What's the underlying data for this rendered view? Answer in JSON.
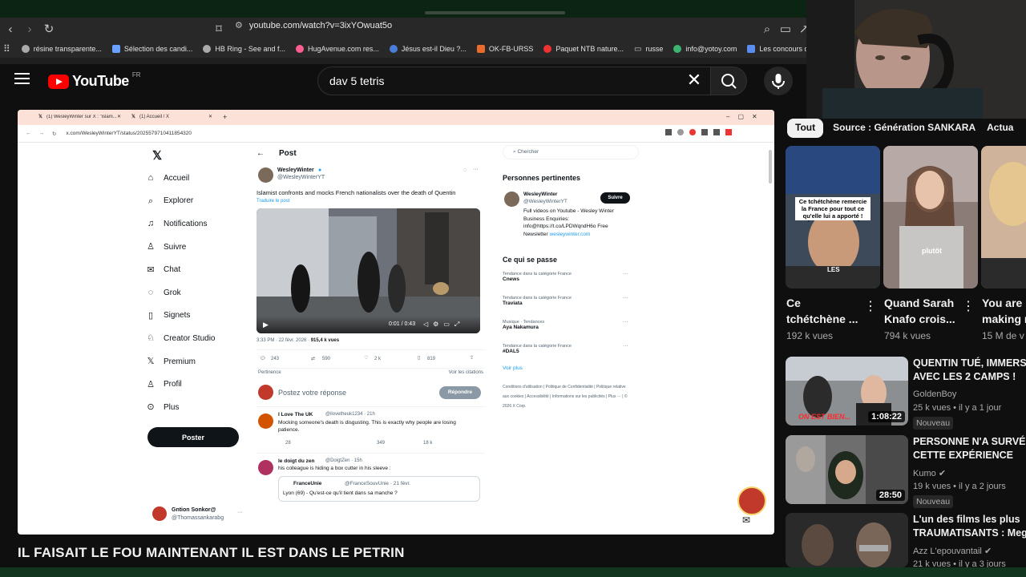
{
  "browser": {
    "url": "youtube.com/watch?v=3ixYOwuat5o",
    "bookmarks": [
      "résine transparente...",
      "Sélection des candi...",
      "HB Ring - See and f...",
      "HugAvenue.com res...",
      "Jésus est-il Dieu ?...",
      "OK-FB-URSS",
      "Paquet NTB nature...",
      "russe",
      "info@yotoy.com",
      "Les concours d'au"
    ]
  },
  "youtube": {
    "logo": "YouTube",
    "region": "FR",
    "search_query": "dav 5 tetris",
    "video_title": "IL FAISAIT LE FOU MAINTENANT IL EST DANS LE PETRIN"
  },
  "inner_browser": {
    "tabs": [
      "(1) WesleyWinter sur X : \"islam...",
      "(1) Accueil / X"
    ],
    "url": "x.com/WesleyWinterYT/status/2025579710411854320"
  },
  "x_sidebar": {
    "items": [
      "Accueil",
      "Explorer",
      "Notifications",
      "Suivre",
      "Chat",
      "Grok",
      "Signets",
      "Creator Studio",
      "Premium",
      "Profil",
      "Plus"
    ],
    "post_button": "Poster",
    "user_name": "Gntion Sonkor@",
    "user_handle": "@Thomassankarabg"
  },
  "x_post": {
    "header": "Post",
    "author": "WesleyWinter",
    "handle": "@WesleyWinterYT",
    "text": "Islamist confronts and mocks French nationalists over the death of Quentin",
    "translate": "Traduire le post",
    "video_time": "0:01 / 0:43",
    "timestamp": "3:33 PM · 22 févr. 2026 · ",
    "views": "915,4 k vues",
    "replies": "243",
    "reposts": "590",
    "likes": "2 k",
    "bookmarks": "819",
    "relevance": "Pertinence",
    "quotes": "Voir les citations",
    "reply_placeholder": "Postez votre réponse",
    "reply_button": "Répondre",
    "reply1": {
      "name": "I Love The UK",
      "handle": "@ilovetheuk1234 · 21h",
      "text": "Mocking someone's death is disgusting. This is exactly why people are losing patience.",
      "r": "28",
      "l": "349",
      "v": "18 k"
    },
    "reply2": {
      "name": "le doigt du zen",
      "handle": "@DoigtZen · 15h",
      "text": "his colleague is hiding a box cutter in his sleeve :"
    },
    "quote": {
      "name": "FranceUnie",
      "handle": "@FranceSouvUnie · 21 févr.",
      "text": "Lyon (69) - Qu'est-ce qu'il tient dans sa manche ?"
    }
  },
  "x_right": {
    "search_placeholder": "Chercher",
    "relevant_title": "Personnes pertinentes",
    "relevant_name": "WesleyWinter",
    "relevant_handle": "@WesleyWinterYT",
    "follow": "Suivre",
    "bio": "Full videos on Youtube - Wesley Winter Business Enquiries: info@https://t.co/LPDWqndH6o Free Newsletter",
    "bio_link": "wesleywinter.com",
    "trending_title": "Ce qui se passe",
    "trends": [
      {
        "cat": "Tendance dans la catégorie France",
        "name": "Cnews"
      },
      {
        "cat": "Tendance dans la catégorie France",
        "name": "Traviata"
      },
      {
        "cat": "Musique · Tendances",
        "name": "Aya Nakamura"
      },
      {
        "cat": "Tendance dans la catégorie France",
        "name": "#DAL5"
      }
    ],
    "see_more": "Voir plus",
    "footer": "Conditions d'utilisation | Politique de Confidentialité | Politique relative aux cookies | Accessibilité | Informations sur les publicités | Plus ··· | © 2026 X Corp."
  },
  "sidebar": {
    "chips": [
      "Tout",
      "Source : Génération SANKARA",
      "Actua"
    ],
    "shorts": [
      {
        "title1": "Ce",
        "title2": "tchétchène ...",
        "views": "192 k vues",
        "overlay": "Ce tchétchène remercie la France pour tout ce qu'elle lui a apporté !",
        "overlay2": "LES"
      },
      {
        "title1": "Quand Sarah",
        "title2": "Knafo crois...",
        "views": "794 k vues",
        "overlay": "plutôt"
      },
      {
        "title1": "You are",
        "title2": "making n",
        "views": "15 M de v"
      }
    ],
    "videos": [
      {
        "title1": "QUENTIN TUÉ, IMMERSIO",
        "title2": "AVEC LES 2 CAMPS !",
        "channel": "GoldenBoy",
        "meta": "25 k vues • il y a 1 jour",
        "badge": "Nouveau",
        "duration": "1:08:22",
        "overlay": "ON EST BIEN..."
      },
      {
        "title1": "PERSONNE N'A SURVÉCU",
        "title2": "CETTE EXPÉRIENCE",
        "channel": "Kumo",
        "meta": "19 k vues • il y a 2 jours",
        "badge": "Nouveau",
        "duration": "28:50"
      },
      {
        "title1": "L'un des films les plus",
        "title2": "TRAUMATISANTS : Mega",
        "channel": "Azz L'epouvantail",
        "meta": "21 k vues • il y a 3 jours"
      }
    ]
  },
  "colors": {
    "yt_bg": "#0f0f0f",
    "yt_red": "#ff0000",
    "x_blue": "#1d9bf0",
    "bookmark_bar": "#282828"
  }
}
